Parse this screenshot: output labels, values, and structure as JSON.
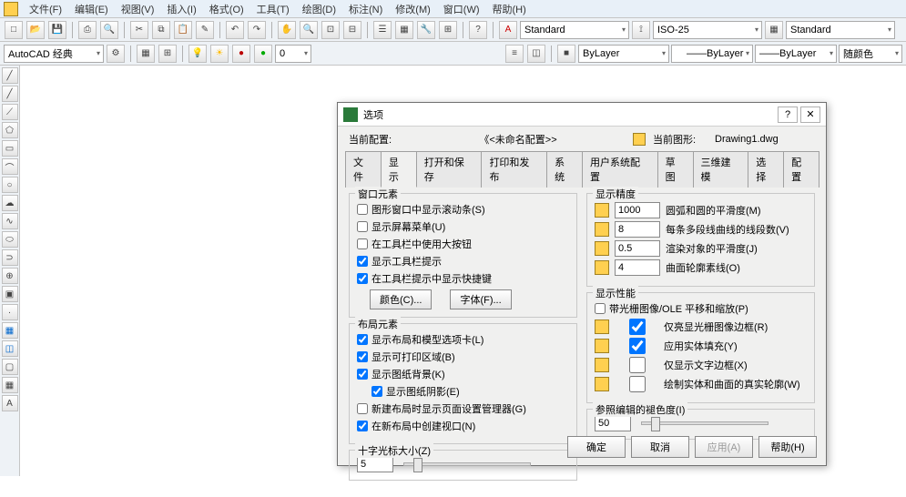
{
  "menu": {
    "items": [
      "文件(F)",
      "编辑(E)",
      "视图(V)",
      "插入(I)",
      "格式(O)",
      "工具(T)",
      "绘图(D)",
      "标注(N)",
      "修改(M)",
      "窗口(W)",
      "帮助(H)"
    ]
  },
  "tb1": {
    "style1": "Standard",
    "style2": "ISO-25",
    "style3": "Standard"
  },
  "tb2": {
    "workspace": "AutoCAD 经典",
    "layer": "ByLayer",
    "color": "ByLayer",
    "ltype": "ByLayer",
    "lwt": "随颜色"
  },
  "dialog": {
    "title": "选项",
    "current_profile_lbl": "当前配置:",
    "current_profile": "《<未命名配置>>",
    "current_dwg_lbl": "当前图形:",
    "current_dwg": "Drawing1.dwg",
    "tabs": [
      "文件",
      "显示",
      "打开和保存",
      "打印和发布",
      "系统",
      "用户系统配置",
      "草图",
      "三维建模",
      "选择",
      "配置"
    ],
    "active_tab": 1,
    "grp_window": "窗口元素",
    "chk_scroll": "图形窗口中显示滚动条(S)",
    "chk_screenmenu": "显示屏幕菜单(U)",
    "chk_bigbtn": "在工具栏中使用大按钮",
    "chk_tooltips": "显示工具栏提示",
    "chk_shortcut": "在工具栏提示中显示快捷键",
    "btn_color": "颜色(C)...",
    "btn_font": "字体(F)...",
    "grp_layout": "布局元素",
    "chk_layouttabs": "显示布局和模型选项卡(L)",
    "chk_printarea": "显示可打印区域(B)",
    "chk_paperbg": "显示图纸背景(K)",
    "chk_papershadow": "显示图纸阴影(E)",
    "chk_pagesetup": "新建布局时显示页面设置管理器(G)",
    "chk_viewport": "在新布局中创建视口(N)",
    "grp_cross": "十字光标大小(Z)",
    "cross_val": "5",
    "grp_res": "显示精度",
    "res1": "1000",
    "res1_lbl": "圆弧和圆的平滑度(M)",
    "res2": "8",
    "res2_lbl": "每条多段线曲线的线段数(V)",
    "res3": "0.5",
    "res3_lbl": "渲染对象的平滑度(J)",
    "res4": "4",
    "res4_lbl": "曲面轮廓素线(O)",
    "grp_perf": "显示性能",
    "chk_ole": "带光栅图像/OLE 平移和缩放(P)",
    "chk_raster": "仅亮显光栅图像边框(R)",
    "chk_solidfill": "应用实体填充(Y)",
    "chk_textframe": "仅显示文字边框(X)",
    "chk_silh": "绘制实体和曲面的真实轮廓(W)",
    "grp_fade": "参照编辑的褪色度(I)",
    "fade_val": "50",
    "btn_ok": "确定",
    "btn_cancel": "取消",
    "btn_apply": "应用(A)",
    "btn_help": "帮助(H)"
  }
}
